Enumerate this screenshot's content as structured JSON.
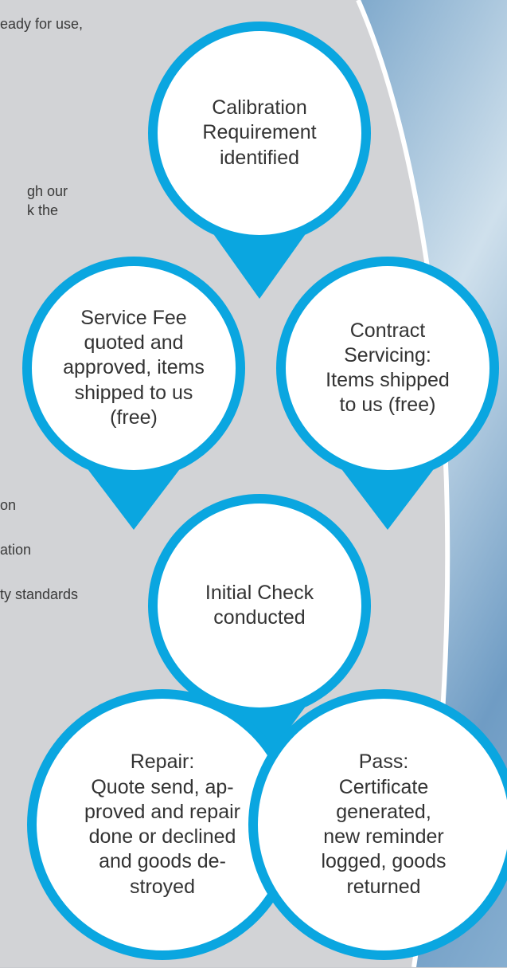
{
  "colors": {
    "ring": "#0aa6e0",
    "fill": "#ffffff",
    "panel": "#d2d3d6",
    "sky": "#8fb6d6",
    "text": "#333333"
  },
  "background_text": [
    "eady for use,",
    "gh our",
    "k the",
    "on",
    "ation",
    "ty standards"
  ],
  "steps": [
    {
      "id": "calibration",
      "text": "Calibration\nRequirement\nidentified"
    },
    {
      "id": "service-fee",
      "text": "Service Fee\nquoted and\napproved, items\nshipped to us\n(free)"
    },
    {
      "id": "contract",
      "text": "Contract\nServicing:\nItems shipped\nto us (free)"
    },
    {
      "id": "initial-check",
      "text": "Initial Check\nconducted"
    },
    {
      "id": "repair",
      "text": "Repair:\nQuote send, ap-\nproved and repair\ndone or declined\nand goods de-\nstroyed"
    },
    {
      "id": "pass",
      "text": "Pass:\nCertificate\ngenerated,\nnew reminder\nlogged, goods\nreturned"
    }
  ]
}
